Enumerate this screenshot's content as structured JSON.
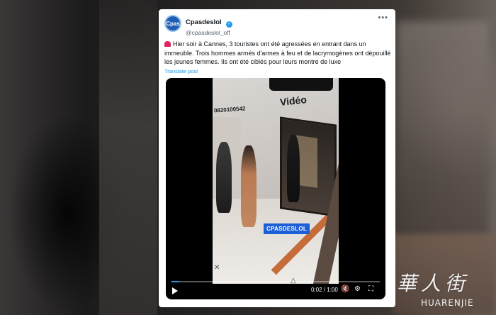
{
  "tweet": {
    "avatar_text": "Cpas",
    "display_name": "Cpasdeslol",
    "handle": "@cpasdeslol_off",
    "text": "Hier soir à Cannes, 3 touristes ont été agressées en entrant dans un immeuble. Trois hommes armés d'armes à feu et de lacrymogènes ont dépouillé les jeunes femmes. Ils ont été ciblés pour leurs montre de luxe",
    "translate_label": "Translate post"
  },
  "video": {
    "overlay_title": "Vidéo",
    "overlay_number": "0820100542",
    "watermark": "CPASDESLOL",
    "time": "0:02 / 1:00",
    "progress": 0.033
  },
  "site_logo": {
    "chinese": "華人街",
    "english": "HUARENJIE"
  }
}
